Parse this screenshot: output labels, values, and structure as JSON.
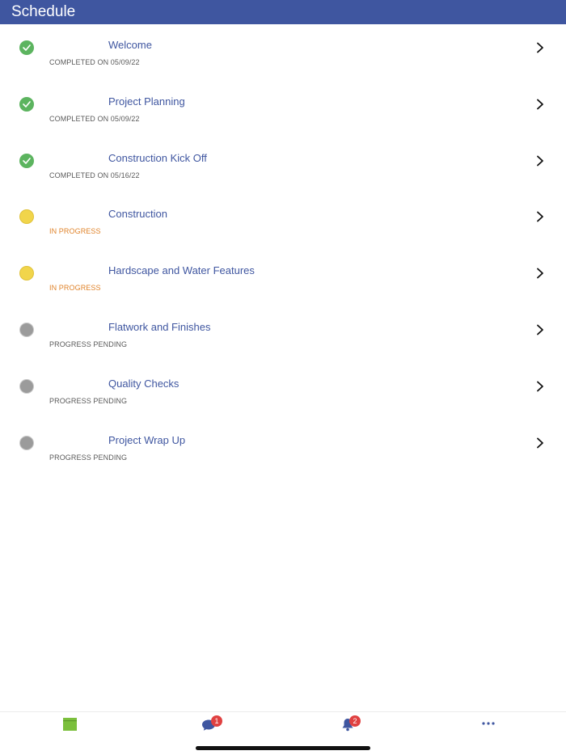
{
  "header": {
    "title": "Schedule"
  },
  "colors": {
    "header_bg": "#3f56a0",
    "title_text": "#3f56a0",
    "completed": "#5cb45f",
    "in_progress": "#f1d54b",
    "in_progress_text": "#e0832a",
    "pending": "#9b9b9b",
    "badge": "#e04141",
    "calendar_tab": "#7bbf3c"
  },
  "schedule": [
    {
      "title": "Welcome",
      "status": "completed",
      "status_text": "COMPLETED ON 05/09/22"
    },
    {
      "title": "Project Planning",
      "status": "completed",
      "status_text": "COMPLETED ON 05/09/22"
    },
    {
      "title": "Construction Kick Off",
      "status": "completed",
      "status_text": "COMPLETED ON 05/16/22"
    },
    {
      "title": "Construction",
      "status": "in-progress",
      "status_text": "IN PROGRESS"
    },
    {
      "title": "Hardscape and Water Features",
      "status": "in-progress",
      "status_text": "IN PROGRESS"
    },
    {
      "title": "Flatwork and Finishes",
      "status": "pending",
      "status_text": "PROGRESS PENDING"
    },
    {
      "title": "Quality Checks",
      "status": "pending",
      "status_text": "PROGRESS PENDING"
    },
    {
      "title": "Project Wrap Up",
      "status": "pending",
      "status_text": "PROGRESS PENDING"
    }
  ],
  "tabbar": {
    "tabs": [
      {
        "icon": "calendar-icon"
      },
      {
        "icon": "chat-bubble-icon",
        "badge": "1"
      },
      {
        "icon": "bell-icon",
        "badge": "2"
      },
      {
        "icon": "more-icon"
      }
    ]
  }
}
